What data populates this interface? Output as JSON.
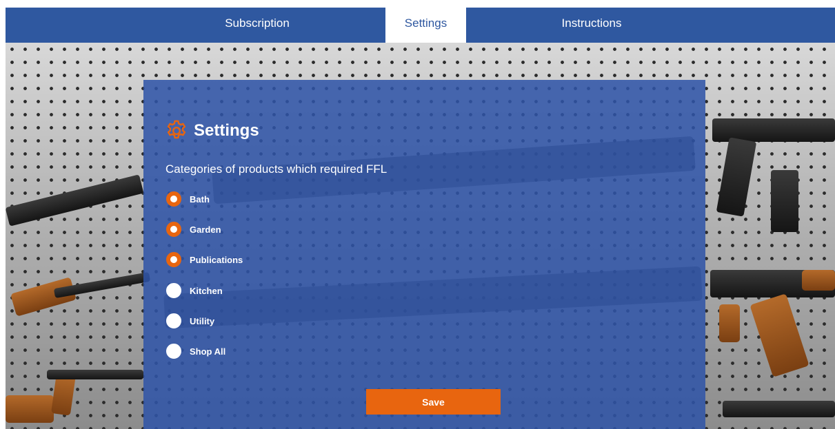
{
  "tabs": [
    {
      "label": "Subscription",
      "active": false
    },
    {
      "label": "Settings",
      "active": true
    },
    {
      "label": "Instructions",
      "active": false
    }
  ],
  "panel": {
    "title": "Settings",
    "title_icon": "gear-icon",
    "subtitle": "Categories of products which required FFL",
    "options": [
      {
        "label": "Bath",
        "checked": true
      },
      {
        "label": "Garden",
        "checked": true
      },
      {
        "label": "Publications",
        "checked": true
      },
      {
        "label": "Kitchen",
        "checked": false
      },
      {
        "label": "Utility",
        "checked": false
      },
      {
        "label": "Shop All",
        "checked": false
      }
    ],
    "save_label": "Save"
  },
  "colors": {
    "nav_bg": "#2f58a0",
    "panel_bg": "#2e54a8",
    "accent": "#e8650f",
    "text": "#ffffff"
  }
}
